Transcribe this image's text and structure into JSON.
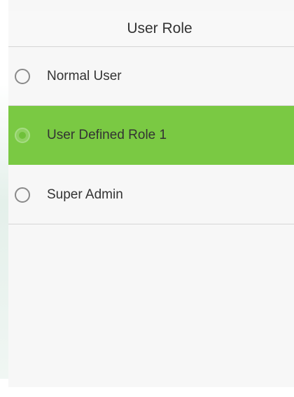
{
  "header": {
    "title": "User Role"
  },
  "roles": {
    "options": [
      {
        "label": "Normal User",
        "selected": false
      },
      {
        "label": "User Defined Role 1",
        "selected": true
      },
      {
        "label": "Super Admin",
        "selected": false
      }
    ]
  },
  "colors": {
    "selected_background": "#7ac943",
    "background": "#f7f7f7",
    "text": "#333333",
    "divider": "#d6d6d6"
  }
}
